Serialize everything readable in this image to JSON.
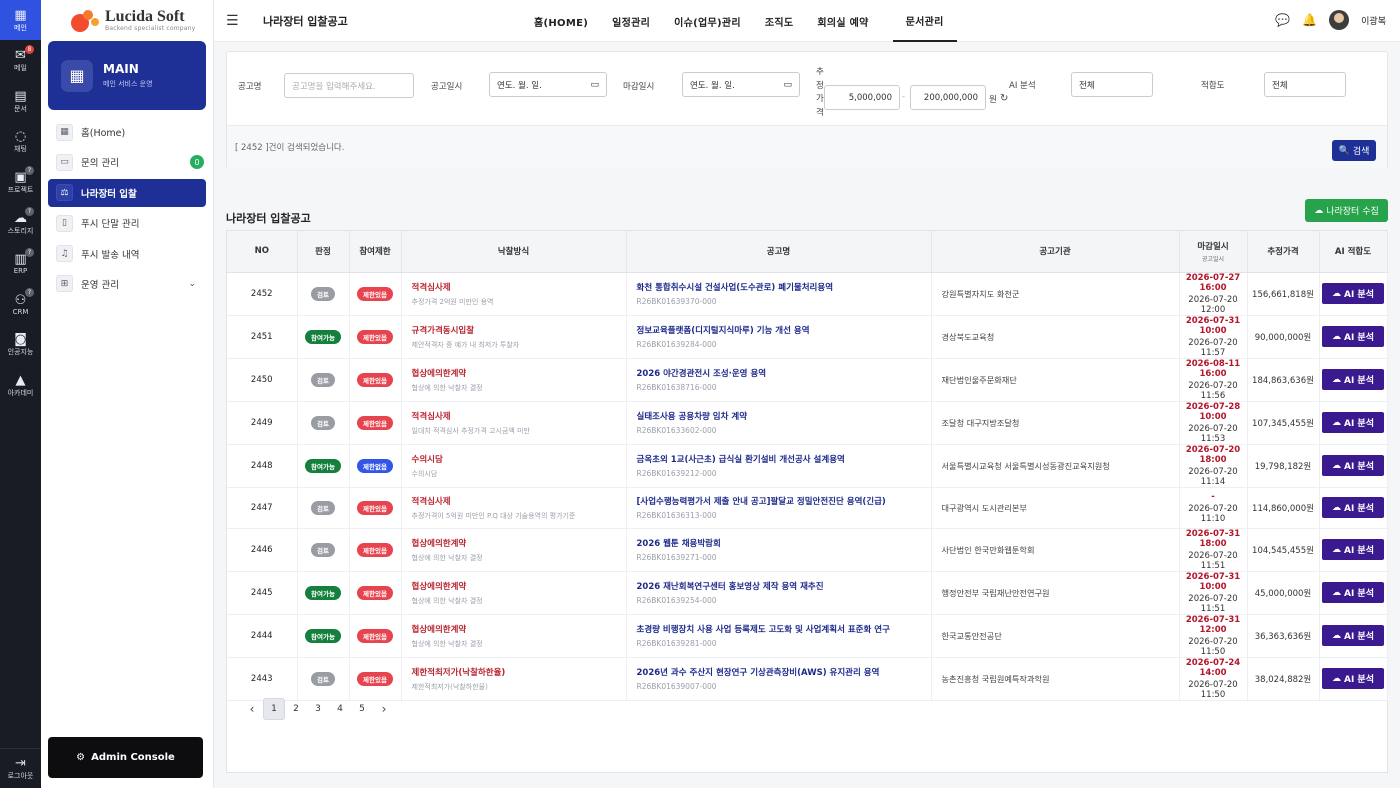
{
  "rail": {
    "items": [
      {
        "label": "메인",
        "icon": "grid-icon"
      },
      {
        "label": "메일",
        "icon": "mail-icon",
        "badge": "8"
      },
      {
        "label": "문서",
        "icon": "book-icon"
      },
      {
        "label": "채팅",
        "icon": "chat-icon"
      },
      {
        "label": "프로젝트",
        "icon": "clipboard-icon",
        "badge": "?"
      },
      {
        "label": "스토리지",
        "icon": "cloud-icon",
        "badge": "?"
      },
      {
        "label": "ERP",
        "icon": "building-icon",
        "badge": "?"
      },
      {
        "label": "CRM",
        "icon": "people-icon",
        "badge": "?"
      },
      {
        "label": "인공지능",
        "icon": "robot-icon"
      },
      {
        "label": "아카데미",
        "icon": "graduation-cap-icon"
      }
    ],
    "logout": "로그아웃"
  },
  "logo": {
    "title": "Lucida Soft",
    "subtitle": "Backend specialist company"
  },
  "main_card": {
    "title": "MAIN",
    "subtitle": "메인 서비스 운영"
  },
  "menu": [
    {
      "label": "홈(Home)"
    },
    {
      "label": "문의 관리",
      "count": "0"
    },
    {
      "label": "나라장터 입찰"
    },
    {
      "label": "푸시 단말 관리"
    },
    {
      "label": "푸시 발송 내역"
    },
    {
      "label": "운영 관리"
    }
  ],
  "admin_console": "Admin Console",
  "topbar": {
    "title": "나라장터 입찰공고",
    "nav": [
      "홈(HOME)",
      "일정관리",
      "이슈(업무)관리",
      "조직도",
      "회의실 예약",
      "문서관리"
    ],
    "user": "이광복"
  },
  "filter": {
    "name_label": "공고명",
    "name_placeholder": "공고명을 입력해주세요.",
    "date_label": "공고일시",
    "date_value": "연도. 월. 일.",
    "deadline_label": "마감일시",
    "deadline_value": "연도. 월. 일.",
    "price_label": "추정가격",
    "price_min": "5,000,000",
    "price_max": "200,000,000",
    "price_sep": "-",
    "price_unit": "원",
    "ai_label": "AI 분석",
    "ai_value": "전체",
    "fit_label": "적합도",
    "fit_value": "전체",
    "result_text": "[ 2452 ]건이 검색되었습니다.",
    "search_label": "검색"
  },
  "section_title": "나라장터 입찰공고",
  "collect_label": "나라장터 수집",
  "table": {
    "headers": {
      "no": "NO",
      "judge": "판정",
      "limit": "참여제한",
      "method": "낙찰방식",
      "name": "공고명",
      "org": "공고기관",
      "deadline": "마감일시",
      "deadline_sub": "공고일시",
      "price": "추정가격",
      "ai": "AI 적합도"
    },
    "ai_button": "AI 분석",
    "rows": [
      {
        "no": "2452",
        "judge": "검토",
        "judge_color": "gray",
        "limit": "제한있음",
        "limit_color": "red",
        "method": "적격심사제",
        "method_sub": "추정가격 2억원 미만인 용역",
        "name": "화천 통합취수시설 건설사업(도수관로) 폐기물처리용역",
        "code": "R26BK01639370-000",
        "org": "강원특별자치도 화천군",
        "deadline": "2026-07-27 16:00",
        "posted": "2026-07-20 12:00",
        "price": "156,661,818원"
      },
      {
        "no": "2451",
        "judge": "참여가능",
        "judge_color": "green",
        "limit": "제한있음",
        "limit_color": "red",
        "method": "규격가격동시입찰",
        "method_sub": "제안적격자 중 예가 내 최저가 투찰자",
        "name": "정보교육플랫폼(디지털지식마루) 기능 개선 용역",
        "code": "R26BK01639284-000",
        "org": "경상북도교육청",
        "deadline": "2026-07-31 10:00",
        "posted": "2026-07-20 11:57",
        "price": "90,000,000원"
      },
      {
        "no": "2450",
        "judge": "검토",
        "judge_color": "gray",
        "limit": "제한있음",
        "limit_color": "red",
        "method": "협상에의한계약",
        "method_sub": "협상에 의한 낙찰자 결정",
        "name": "2026 야간경관전시 조성·운영 용역",
        "code": "R26BK01638716-000",
        "org": "재단법인울주문화재단",
        "deadline": "2026-08-11 16:00",
        "posted": "2026-07-20 11:56",
        "price": "184,863,636원"
      },
      {
        "no": "2449",
        "judge": "검토",
        "judge_color": "gray",
        "limit": "제한있음",
        "limit_color": "red",
        "method": "적격심사제",
        "method_sub": "일대치 적격심사 추정가격 고시금액 미만",
        "name": "실태조사용 공용차량 임차 계약",
        "code": "R26BK01633602-000",
        "org": "조달청 대구지방조달청",
        "deadline": "2026-07-28 10:00",
        "posted": "2026-07-20 11:53",
        "price": "107,345,455원"
      },
      {
        "no": "2448",
        "judge": "참여가능",
        "judge_color": "green",
        "limit": "제한없음",
        "limit_color": "blue",
        "method": "수의시담",
        "method_sub": "수의시담",
        "name": "금옥초외 1교(사근초) 급식실 환기설비 개선공사 설계용역",
        "code": "R26BK01639212-000",
        "org": "서울특별시교육청 서울특별시성동광진교육지원청",
        "deadline": "2026-07-20 18:00",
        "posted": "2026-07-20 11:14",
        "price": "19,798,182원"
      },
      {
        "no": "2447",
        "judge": "검토",
        "judge_color": "gray",
        "limit": "제한있음",
        "limit_color": "red",
        "method": "적격심사제",
        "method_sub": "추정가격이 5억원 미만인 P.Q 대상 기술용역의 평가기준",
        "name": "[사업수행능력평가서 제출 안내 공고]팔달교 정밀안전진단 용역(긴급)",
        "code": "R26BK01636313-000",
        "org": "대구광역시 도시관리본부",
        "deadline": "-",
        "posted": "2026-07-20 11:10",
        "price": "114,860,000원"
      },
      {
        "no": "2446",
        "judge": "검토",
        "judge_color": "gray",
        "limit": "제한있음",
        "limit_color": "red",
        "method": "협상에의한계약",
        "method_sub": "협상에 의한 낙찰자 결정",
        "name": "2026 웹툰 채용박람회",
        "code": "R26BK01639271-000",
        "org": "사단법인 한국만화웹툰학회",
        "deadline": "2026-07-31 18:00",
        "posted": "2026-07-20 11:51",
        "price": "104,545,455원"
      },
      {
        "no": "2445",
        "judge": "참여가능",
        "judge_color": "green",
        "limit": "제한있음",
        "limit_color": "red",
        "method": "협상에의한계약",
        "method_sub": "협상에 의한 낙찰자 결정",
        "name": "2026 재난회복연구센터 홍보영상 제작 용역 재추진",
        "code": "R26BK01639254-000",
        "org": "행정안전부 국립재난안전연구원",
        "deadline": "2026-07-31 10:00",
        "posted": "2026-07-20 11:51",
        "price": "45,000,000원"
      },
      {
        "no": "2444",
        "judge": "참여가능",
        "judge_color": "green",
        "limit": "제한있음",
        "limit_color": "red",
        "method": "협상에의한계약",
        "method_sub": "협상에 의한 낙찰자 결정",
        "name": "초경량 비행장치 사용 사업 등록제도 고도화 및 사업계획서 표준화 연구",
        "code": "R26BK01639281-000",
        "org": "한국교통안전공단",
        "deadline": "2026-07-31 12:00",
        "posted": "2026-07-20 11:50",
        "price": "36,363,636원"
      },
      {
        "no": "2443",
        "judge": "검토",
        "judge_color": "gray",
        "limit": "제한있음",
        "limit_color": "red",
        "method": "제한적최저가(낙찰하한율)",
        "method_sub": "제한적최저가(낙찰하한율)",
        "name": "2026년 과수 주산지 현장연구 기상관측장비(AWS) 유지관리 용역",
        "code": "R26BK01639007-000",
        "org": "농촌진흥청 국립원예특작과학원",
        "deadline": "2026-07-24 14:00",
        "posted": "2026-07-20 11:50",
        "price": "38,024,882원"
      }
    ]
  },
  "pagination": {
    "pages": [
      "1",
      "2",
      "3",
      "4",
      "5"
    ],
    "current": "1"
  }
}
